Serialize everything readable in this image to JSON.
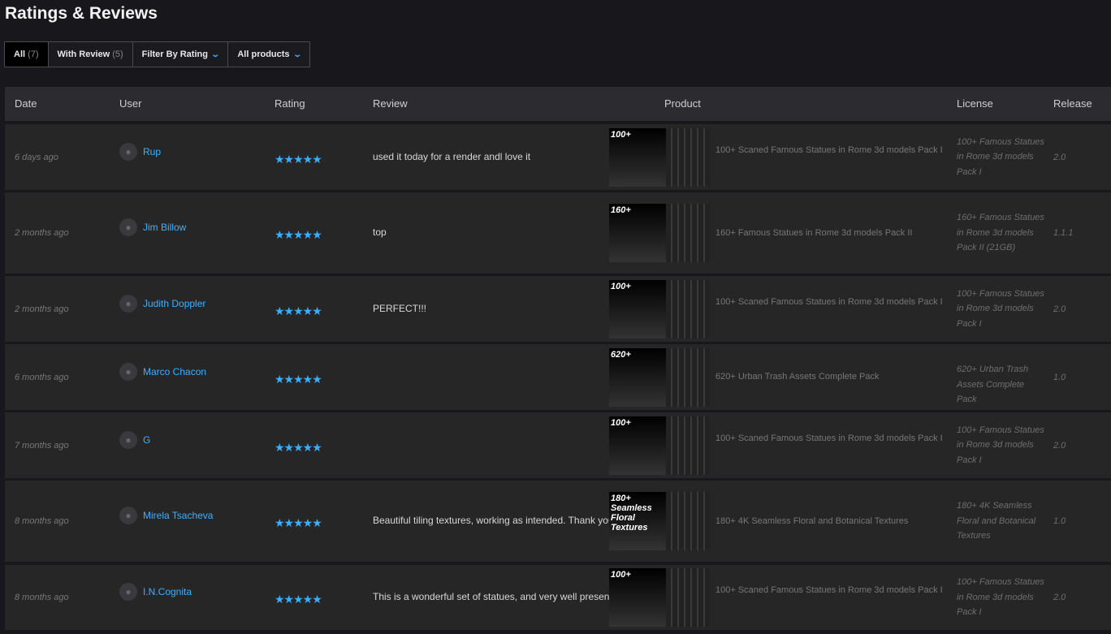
{
  "title": "Ratings & Reviews",
  "filters": {
    "all": "All",
    "all_count": "(7)",
    "with_review": "With Review",
    "with_review_count": "(5)",
    "by_rating": "Filter By Rating",
    "products": "All products"
  },
  "columns": {
    "date": "Date",
    "user": "User",
    "rating": "Rating",
    "review": "Review",
    "product": "Product",
    "license": "License",
    "release": "Release"
  },
  "accent": "#3aaeff",
  "rows": [
    {
      "date": "6 days ago",
      "user": "Rup",
      "stars": 5,
      "stars_text": "★★★★★",
      "review": "used it today for a render andl love it",
      "img_label": "100+",
      "product": "100+ Scaned Famous Statues in Rome 3d models Pack I",
      "license": "100+ Famous Statues in Rome 3d models Pack I",
      "release": "2.0"
    },
    {
      "date": "2 months ago",
      "user": "Jim Billow",
      "stars": 5,
      "stars_text": "★★★★★",
      "review": "top",
      "img_label": "160+",
      "product": "160+ Famous Statues in Rome 3d models Pack II",
      "license": "160+ Famous Statues in Rome 3d models Pack II (21GB)",
      "release": "1.1.1"
    },
    {
      "date": "2 months ago",
      "user": "Judith Doppler",
      "stars": 5,
      "stars_text": "★★★★★",
      "review": "PERFECT!!!",
      "img_label": "100+",
      "product": "100+ Scaned Famous Statues in Rome 3d models Pack I",
      "license": "100+ Famous Statues in Rome 3d models Pack I",
      "release": "2.0"
    },
    {
      "date": "6 months ago",
      "user": "Marco Chacon",
      "stars": 5,
      "stars_text": "★★★★★",
      "review": "",
      "img_label": "620+",
      "product": "620+ Urban Trash Assets Complete Pack",
      "license": "620+ Urban Trash Assets Complete Pack",
      "release": "1.0"
    },
    {
      "date": "7 months ago",
      "user": "G",
      "stars": 5,
      "stars_text": "★★★★★",
      "review": "",
      "img_label": "100+",
      "product": "100+ Scaned Famous Statues in Rome 3d models Pack I",
      "license": "100+ Famous Statues in Rome 3d models Pack I",
      "release": "2.0"
    },
    {
      "date": "8 months ago",
      "user": "Mirela Tsacheva",
      "stars": 5,
      "stars_text": "★★★★★",
      "review": "Beautiful tiling textures, working as intended. Thank you!",
      "img_label": "180+ Seamless Floral Textures",
      "product": "180+ 4K Seamless Floral and Botanical Textures",
      "license": "180+ 4K Seamless Floral and Botanical Textures",
      "release": "1.0"
    },
    {
      "date": "8 months ago",
      "user": "I.N.Cognita",
      "stars": 5,
      "stars_text": "★★★★★",
      "review": "This is a wonderful set of statues, and very well presented.",
      "img_label": "100+",
      "product": "100+ Scaned Famous Statues in Rome 3d models Pack I",
      "license": "100+ Famous Statues in Rome 3d models Pack I",
      "release": "2.0"
    }
  ]
}
